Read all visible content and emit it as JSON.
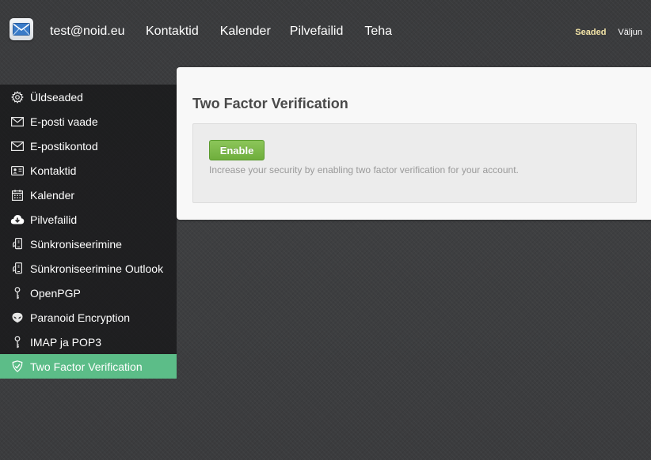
{
  "header": {
    "account": "test@noid.eu",
    "nav": [
      {
        "label": "Kontaktid"
      },
      {
        "label": "Kalender"
      },
      {
        "label": "Pilvefailid"
      },
      {
        "label": "Teha"
      }
    ],
    "settings_label": "Seaded",
    "logout_label": "Väljun"
  },
  "sidebar": {
    "items": [
      {
        "label": "Üldseaded",
        "icon": "gear-icon"
      },
      {
        "label": "E-posti vaade",
        "icon": "envelope-icon"
      },
      {
        "label": "E-postikontod",
        "icon": "envelope-icon"
      },
      {
        "label": "Kontaktid",
        "icon": "contact-card-icon"
      },
      {
        "label": "Kalender",
        "icon": "calendar-icon"
      },
      {
        "label": "Pilvefailid",
        "icon": "cloud-download-icon"
      },
      {
        "label": "Sünkroniseerimine",
        "icon": "sync-device-icon"
      },
      {
        "label": "Sünkroniseerimine Outlook",
        "icon": "sync-device-icon"
      },
      {
        "label": "OpenPGP",
        "icon": "key-icon"
      },
      {
        "label": "Paranoid Encryption",
        "icon": "alien-icon"
      },
      {
        "label": "IMAP ja POP3",
        "icon": "key-icon"
      },
      {
        "label": "Two Factor Verification",
        "icon": "shield-icon",
        "active": true
      }
    ]
  },
  "main": {
    "title": "Two Factor Verification",
    "enable_label": "Enable",
    "help_text": "Increase your security by enabling two factor verification for your account."
  },
  "colors": {
    "active_item": "#5cbd88",
    "enable_button": "#7cb84a",
    "settings_link": "#f5e6a8"
  }
}
